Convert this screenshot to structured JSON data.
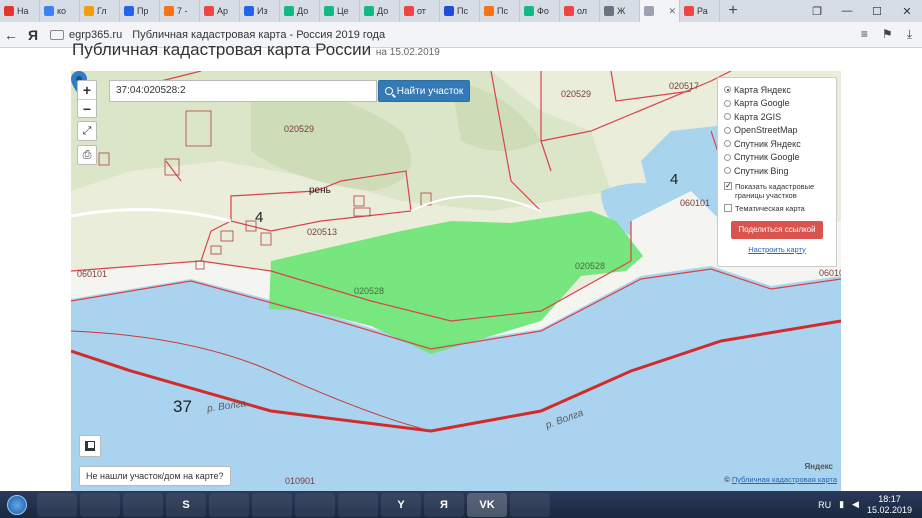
{
  "browser": {
    "tabs": [
      {
        "title": "На",
        "color": "#e3342f"
      },
      {
        "title": "ко",
        "color": "#3b82f6"
      },
      {
        "title": "Гл",
        "color": "#f59e0b"
      },
      {
        "title": "Пр",
        "color": "#2563eb"
      },
      {
        "title": "7 -",
        "color": "#f97316"
      },
      {
        "title": "Ар",
        "color": "#ef4444"
      },
      {
        "title": "Из",
        "color": "#2563eb"
      },
      {
        "title": "До",
        "color": "#10b981"
      },
      {
        "title": "Це",
        "color": "#10b981"
      },
      {
        "title": "До",
        "color": "#10b981"
      },
      {
        "title": "от",
        "color": "#ef4444"
      },
      {
        "title": "Пс",
        "color": "#1d4ed8"
      },
      {
        "title": "Пс",
        "color": "#f97316"
      },
      {
        "title": "Фо",
        "color": "#10b981"
      },
      {
        "title": "ол",
        "color": "#ef4444"
      },
      {
        "title": "Ж",
        "color": "#6b7280"
      },
      {
        "title": "",
        "color": "#9ca3af",
        "active": true
      },
      {
        "title": "Ра",
        "color": "#ef4444"
      }
    ],
    "new_tab": "+",
    "back": "←",
    "yandex": "Я",
    "host": "egrp365.ru",
    "page_title": "Публичная кадастровая карта - Россия 2019 года"
  },
  "page": {
    "heading": "Публичная кадастровая карта России",
    "date": "на 15.02.2019"
  },
  "map": {
    "search_value": "37:04:020528:2",
    "find_button": "Найти участок",
    "zoom_in": "+",
    "zoom_out": "−",
    "layers": [
      {
        "label": "Карта Яндекс",
        "selected": true
      },
      {
        "label": "Карта Google",
        "selected": false
      },
      {
        "label": "Карта 2GIS",
        "selected": false
      },
      {
        "label": "OpenStreetMap",
        "selected": false
      },
      {
        "label": "Спутник Яндекс",
        "selected": false
      },
      {
        "label": "Спутник Google",
        "selected": false
      },
      {
        "label": "Спутник Bing",
        "selected": false
      }
    ],
    "show_borders": "Показать кадастровые границы участков",
    "thematic": "Тематическая карта",
    "share_button": "Поделиться ссылкой",
    "configure_link": "Настроить карту",
    "not_found": "Не нашли участок/дом на карте?",
    "copyright_prefix": "©",
    "copyright_link": "Публичная кадастровая карта",
    "yandex_logo": "Яндекс",
    "labels": {
      "q_020529_a": "020529",
      "q_020529_b": "020529",
      "q_020513": "020513",
      "q_020528_a": "020528",
      "q_020528_b": "020528",
      "q_060101_a": "060101",
      "q_060101_b": "060101",
      "q_010901": "010901",
      "q_020517": "020517",
      "q_06010": "06010",
      "district_4_a": "4",
      "district_4_b": "4",
      "region_37": "37",
      "village": "рень",
      "river_1": "р. Волга",
      "river_2": "р. Волга"
    }
  },
  "taskbar": {
    "items": [
      "",
      "",
      "",
      "S",
      "",
      "",
      "",
      "",
      "Y",
      "Я",
      "VK",
      ""
    ],
    "lang": "RU",
    "time": "18:17",
    "date": "15.02.2019"
  }
}
